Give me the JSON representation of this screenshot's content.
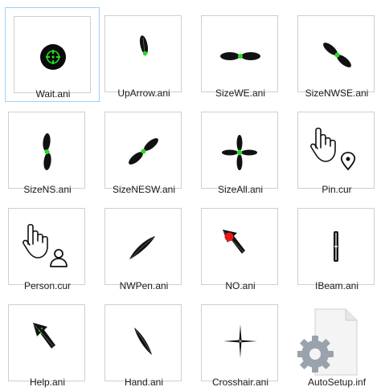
{
  "files": [
    {
      "name": "Wait.ani",
      "icon": "wait-cursor-icon",
      "selected": true
    },
    {
      "name": "UpArrow.ani",
      "icon": "up-arrow-cursor-icon"
    },
    {
      "name": "SizeWE.ani",
      "icon": "size-we-cursor-icon"
    },
    {
      "name": "SizeNWSE.ani",
      "icon": "size-nwse-cursor-icon"
    },
    {
      "name": "SizeNS.ani",
      "icon": "size-ns-cursor-icon"
    },
    {
      "name": "SizeNESW.ani",
      "icon": "size-nesw-cursor-icon"
    },
    {
      "name": "SizeAll.ani",
      "icon": "size-all-cursor-icon"
    },
    {
      "name": "Pin.cur",
      "icon": "hand-pin-cursor-icon"
    },
    {
      "name": "Person.cur",
      "icon": "hand-person-cursor-icon"
    },
    {
      "name": "NWPen.ani",
      "icon": "pen-cursor-icon"
    },
    {
      "name": "NO.ani",
      "icon": "no-cursor-icon"
    },
    {
      "name": "IBeam.ani",
      "icon": "ibeam-cursor-icon"
    },
    {
      "name": "Help.ani",
      "icon": "help-cursor-icon"
    },
    {
      "name": "Hand.ani",
      "icon": "hand-cursor-icon"
    },
    {
      "name": "Crosshair.ani",
      "icon": "crosshair-cursor-icon"
    },
    {
      "name": "AutoSetup.inf",
      "icon": "settings-file-icon"
    }
  ],
  "colors": {
    "accent_green": "#22dd22",
    "selection_border": "#99d1ff",
    "cursor_black": "#111111",
    "no_red": "#e81818"
  }
}
